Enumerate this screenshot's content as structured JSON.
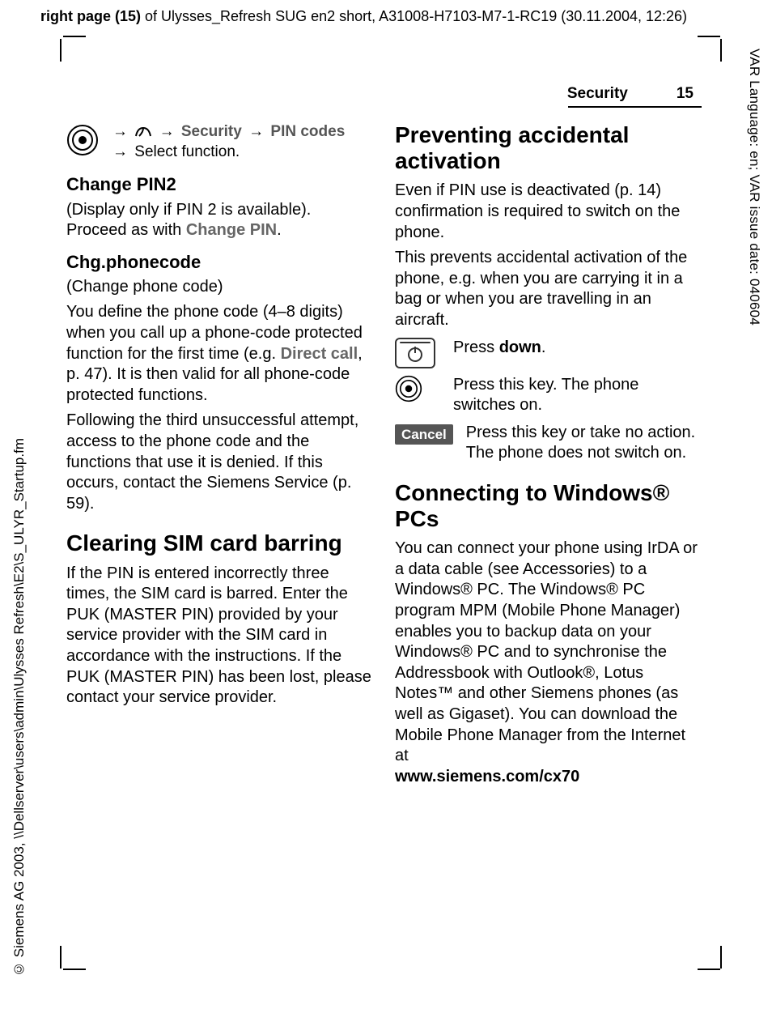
{
  "meta": {
    "top_line_prefix": "right page (15)",
    "top_line_rest": " of Ulysses_Refresh SUG en2 short, A31008-H7103-M7-1-RC19 (30.11.2004, 12:26)",
    "side_right": "VAR Language: en; VAR issue date: 040604",
    "side_left": "© Siemens AG 2003, \\\\Dellserver\\users\\admin\\Ulysses Refresh\\E2\\S_ULYR_Startup.fm"
  },
  "header": {
    "section": "Security",
    "page": "15"
  },
  "left": {
    "nav": {
      "seg1": "Security",
      "seg2": "PIN codes",
      "line2": "Select function."
    },
    "h_change_pin2": "Change PIN2",
    "p_change_pin2_a": "(Display only if PIN 2 is available). Proceed as with ",
    "p_change_pin2_b": "Change PIN",
    "p_change_pin2_c": ".",
    "h_chg_phonecode": "Chg.phonecode",
    "p_chg_sub": "(Change phone code)",
    "p_chg_body_a": "You define the phone code (4–8 digits) when you call up a phone-code protected function for the first time (e.g. ",
    "p_chg_body_b": "Direct call",
    "p_chg_body_c": ", p. 47). It is then valid for all phone-code protected functions.",
    "p_chg_body2": "Following the third unsuccessful attempt, access to the phone code and the functions that use it is denied. If this occurs, contact the Siemens Service (p. 59).",
    "h_clear_sim": "Clearing SIM card barring",
    "p_clear_sim": "If the PIN is entered incorrectly three times, the SIM card is barred. Enter the PUK (MASTER PIN) provided by your service provider with the SIM card in accordance with the instructions. If the PUK (MASTER PIN) has been lost, please contact your service provider."
  },
  "right": {
    "h_prevent": "Preventing accidental activation",
    "p_prevent1": "Even if PIN use is deactivated (p. 14) confirmation is required to switch on the phone.",
    "p_prevent2": "This prevents accidental activation of the phone, e.g. when you are carrying it in a bag or when you are travelling in an aircraft.",
    "k1_a": "Press ",
    "k1_b": "down",
    "k1_c": ".",
    "k2": "Press this key. The phone switches on.",
    "k3_label": "Cancel",
    "k3_text": "Press this key or take no action. The phone does not switch on.",
    "h_connect": "Connecting to Windows® PCs",
    "p_connect": "You can connect your phone using IrDA or a data cable (see Accessories) to a Windows® PC. The Windows® PC program MPM (Mobile Phone Manager) enables you to backup data on your Windows® PC and to synchronise the Addressbook with Outlook®, Lotus Notes™ and other Siemens phones (as well as Gigaset). You can download the Mobile Phone Manager from the Internet at",
    "url": "www.siemens.com/cx70"
  }
}
